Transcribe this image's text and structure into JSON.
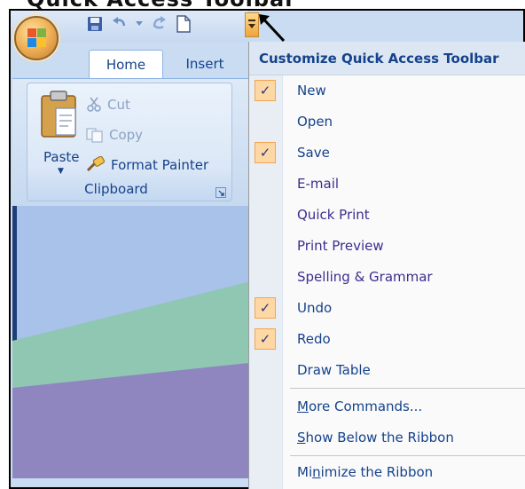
{
  "caption": {
    "text": "Quick Access Toolbar"
  },
  "office_button": {
    "icon": "office-logo-icon"
  },
  "qat": {
    "buttons": [
      {
        "name": "save",
        "icon": "save-icon"
      },
      {
        "name": "undo",
        "icon": "undo-icon"
      },
      {
        "name": "redo",
        "icon": "redo-icon"
      },
      {
        "name": "new",
        "icon": "new-document-icon"
      }
    ],
    "dropdown_icon": "customize-dropdown-icon"
  },
  "tabs": [
    {
      "label": "Home",
      "active": true
    },
    {
      "label": "Insert",
      "active": false
    }
  ],
  "clipboard": {
    "paste_label": "Paste",
    "cut_label": "Cut",
    "copy_label": "Copy",
    "format_painter_label": "Format Painter",
    "group_label": "Clipboard"
  },
  "menu": {
    "title": "Customize Quick Access Toolbar",
    "items": [
      {
        "label": "New",
        "checked": true
      },
      {
        "label": "Open",
        "checked": false
      },
      {
        "label": "Save",
        "checked": true
      },
      {
        "label": "E-mail",
        "checked": false
      },
      {
        "label": "Quick Print",
        "checked": false
      },
      {
        "label": "Print Preview",
        "checked": false
      },
      {
        "label": "Spelling & Grammar",
        "checked": false
      },
      {
        "label": "Undo",
        "checked": true
      },
      {
        "label": "Redo",
        "checked": true
      },
      {
        "label": "Draw Table",
        "checked": false
      }
    ],
    "more_commands": {
      "mnemonic": "M",
      "rest": "ore Commands..."
    },
    "show_below": {
      "mnemonic": "S",
      "rest": "how Below the Ribbon"
    },
    "minimize": {
      "before": "Mi",
      "mnemonic": "n",
      "after": "imize the Ribbon"
    },
    "check_glyph": "✓"
  },
  "colors": {
    "accent_text": "#15428b",
    "check_bg": "#fdd7a4",
    "check_border": "#f0a652",
    "ribbon_bg": "#dde9f7"
  }
}
